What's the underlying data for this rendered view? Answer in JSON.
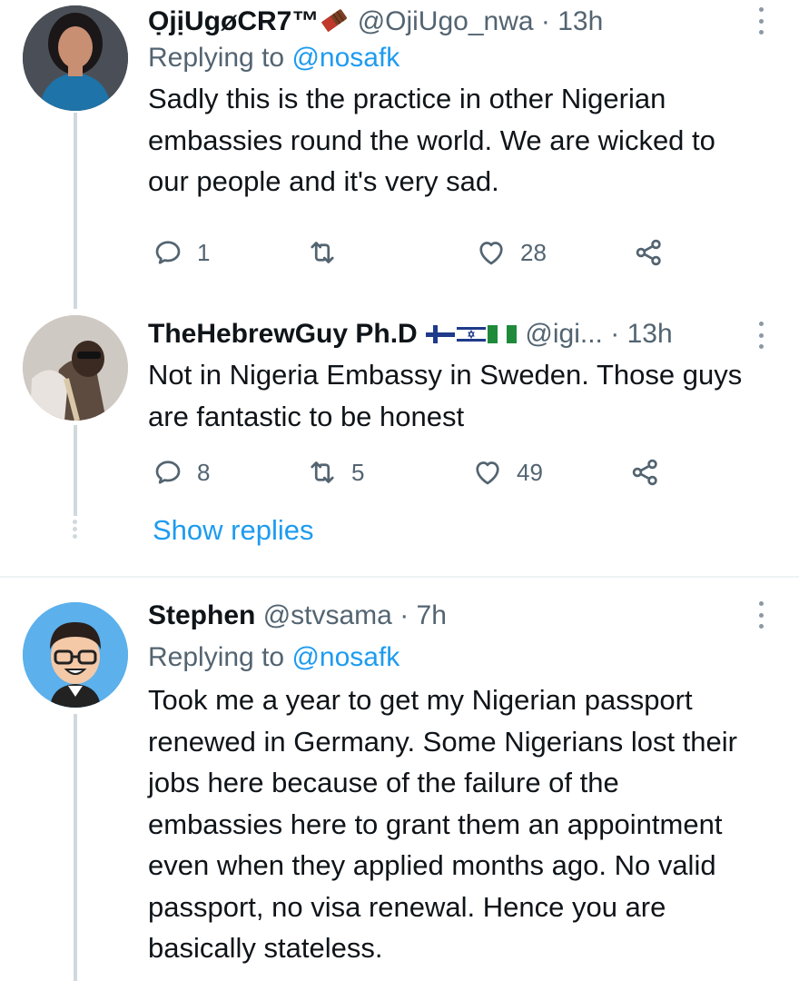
{
  "tweets": [
    {
      "display_name": "ỌjịUgøCR7™",
      "handle": "@OjiUgo_nwa",
      "dot": "·",
      "time": "13h",
      "replying_prefix": "Replying to ",
      "replying_to": "@nosafk",
      "body": "Sadly this is the practice in other Nigerian embassies round the world. We are wicked to our people and it's very sad.",
      "reply_count": "1",
      "retweet_count": "",
      "like_count": "28"
    },
    {
      "display_name": "TheHebrewGuy Ph.D",
      "handle": "@igi...",
      "dot": "·",
      "time": "13h",
      "body": "Not in Nigeria Embassy in Sweden. Those guys are fantastic to be honest",
      "reply_count": "8",
      "retweet_count": "5",
      "like_count": "49"
    },
    {
      "display_name": "Stephen",
      "handle": "@stvsama",
      "dot": "·",
      "time": "7h",
      "replying_prefix": "Replying to ",
      "replying_to": "@nosafk",
      "body": "Took me a year to get my Nigerian passport renewed in Germany. Some Nigerians lost their jobs here because of the failure of the embassies here to grant them an appointment even when they applied months ago. No valid passport, no visa renewal. Hence you are basically stateless."
    }
  ],
  "show_replies_label": "Show replies",
  "colors": {
    "text": "#0f1419",
    "secondary": "#536471",
    "accent": "#1d9bf0",
    "thread_line": "#cfd9de",
    "divider": "#eff3f4"
  },
  "icons": [
    "chocolate-emoji-icon",
    "finland-flag-icon",
    "israel-flag-icon",
    "nigeria-flag-icon",
    "reply-icon",
    "retweet-icon",
    "like-icon",
    "share-icon",
    "more-icon"
  ]
}
